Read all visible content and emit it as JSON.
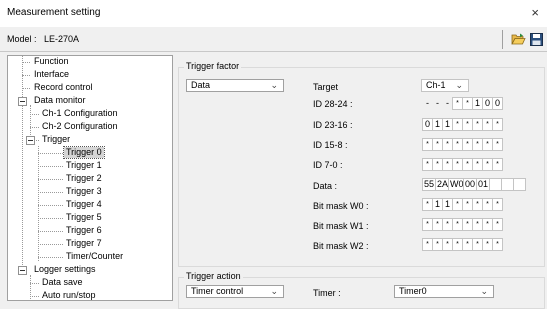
{
  "window": {
    "title": "Measurement setting",
    "close_glyph": "×"
  },
  "model": {
    "label": "Model :",
    "value": "LE-270A"
  },
  "toolbar": {
    "open_icon": "folder-open-icon",
    "save_icon": "save-disk-icon"
  },
  "tree": {
    "function": "Function",
    "interface": "Interface",
    "record_control": "Record control",
    "data_monitor": "Data monitor",
    "ch1_config": "Ch-1 Configuration",
    "ch2_config": "Ch-2 Configuration",
    "trigger": "Trigger",
    "triggers": [
      "Trigger 0",
      "Trigger 1",
      "Trigger 2",
      "Trigger 3",
      "Trigger 4",
      "Trigger 5",
      "Trigger 6",
      "Trigger 7"
    ],
    "timer_counter": "Timer/Counter",
    "logger_settings": "Logger settings",
    "data_save": "Data save",
    "auto_run_stop": "Auto run/stop"
  },
  "trigger_factor": {
    "group_title": "Trigger factor",
    "factor_value": "Data",
    "target_label": "Target",
    "target_value": "Ch-1",
    "rows": [
      {
        "label": "ID 28-24 :",
        "cells": [
          "-",
          "-",
          "-",
          "*",
          "*",
          "1",
          "0",
          "0"
        ]
      },
      {
        "label": "ID 23-16 :",
        "cells": [
          "0",
          "1",
          "1",
          "*",
          "*",
          "*",
          "*",
          "*"
        ]
      },
      {
        "label": "ID 15-8 :",
        "cells": [
          "*",
          "*",
          "*",
          "*",
          "*",
          "*",
          "*",
          "*"
        ]
      },
      {
        "label": "ID 7-0 :",
        "cells": [
          "*",
          "*",
          "*",
          "*",
          "*",
          "*",
          "*",
          "*"
        ]
      }
    ],
    "data_label": "Data :",
    "data_cells": [
      "55",
      "2A",
      "W0",
      "00",
      "01",
      "",
      "",
      ""
    ],
    "masks": [
      {
        "label": "Bit mask W0 :",
        "cells": [
          "*",
          "1",
          "1",
          "*",
          "*",
          "*",
          "*",
          "*"
        ]
      },
      {
        "label": "Bit mask W1 :",
        "cells": [
          "*",
          "*",
          "*",
          "*",
          "*",
          "*",
          "*",
          "*"
        ]
      },
      {
        "label": "Bit mask W2 :",
        "cells": [
          "*",
          "*",
          "*",
          "*",
          "*",
          "*",
          "*",
          "*"
        ]
      }
    ]
  },
  "trigger_action": {
    "group_title": "Trigger action",
    "action_value": "Timer control",
    "timer_label": "Timer :",
    "timer_value": "Timer0"
  }
}
